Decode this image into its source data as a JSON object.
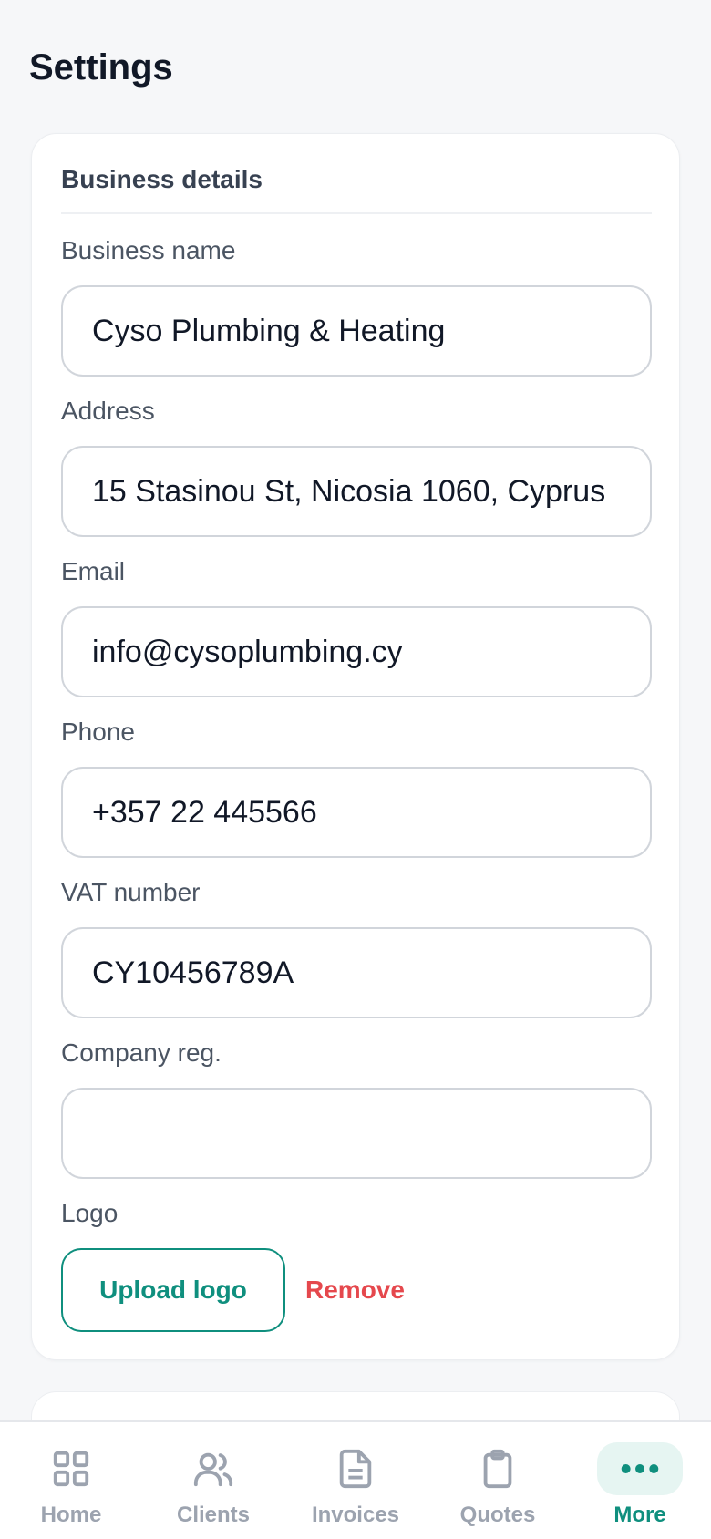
{
  "page": {
    "title": "Settings"
  },
  "business": {
    "section_title": "Business details",
    "fields": [
      {
        "label": "Business name",
        "value": "Cyso Plumbing & Heating"
      },
      {
        "label": "Address",
        "value": "15 Stasinou St, Nicosia 1060, Cyprus"
      },
      {
        "label": "Email",
        "value": "info@cysoplumbing.cy"
      },
      {
        "label": "Phone",
        "value": "+357 22 445566"
      },
      {
        "label": "VAT number",
        "value": "CY10456789A"
      },
      {
        "label": "Company reg.",
        "value": ""
      }
    ],
    "logo": {
      "label": "Logo",
      "upload_label": "Upload logo",
      "remove_label": "Remove"
    }
  },
  "nav": {
    "items": [
      {
        "label": "Home",
        "icon": "grid-icon"
      },
      {
        "label": "Clients",
        "icon": "users-icon"
      },
      {
        "label": "Invoices",
        "icon": "document-icon"
      },
      {
        "label": "Quotes",
        "icon": "clipboard-icon"
      },
      {
        "label": "More",
        "icon": "more-dots-icon"
      }
    ],
    "active": "More"
  },
  "colors": {
    "accent": "#0f8f7e",
    "danger": "#e5484d",
    "muted": "#9ca3af",
    "background": "#f6f7f9"
  }
}
